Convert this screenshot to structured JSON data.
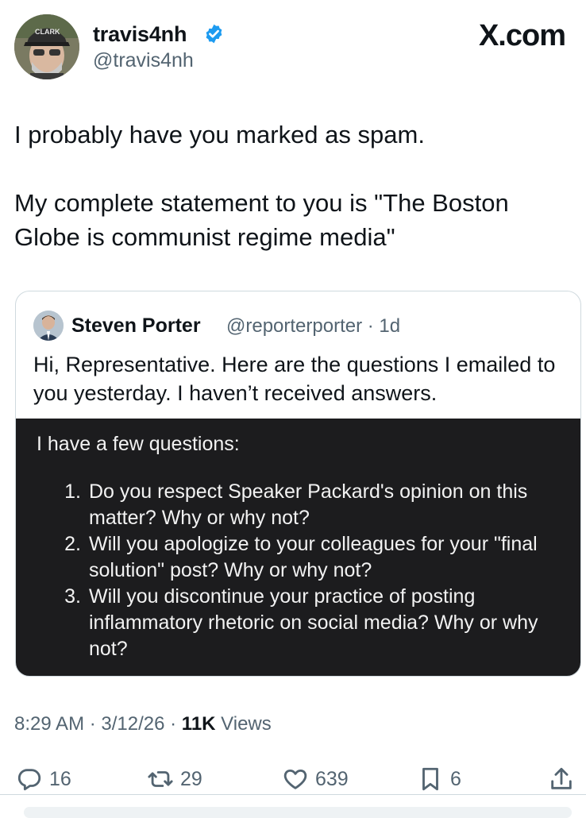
{
  "author": {
    "display_name": "travis4nh",
    "handle": "@travis4nh",
    "verified": true,
    "cap_text": "CLARK"
  },
  "brand": "X.com",
  "tweet": {
    "paragraph_1": "I probably have you marked as spam.",
    "paragraph_2": "My complete statement to you is \"The Boston Globe is communist regime media\""
  },
  "quote": {
    "name": "Steven Porter",
    "handle": "@reporterporter",
    "time": "· 1d",
    "text": "Hi, Representative. Here are the questions I emailed to you yesterday. I haven’t received answers.",
    "media": {
      "heading": "I have a few questions:",
      "items": [
        {
          "num": "1.",
          "text": "Do you respect Speaker Packard's opinion on this matter? Why or why not?"
        },
        {
          "num": "2.",
          "text": "Will you apologize to your colleagues for your \"final solution\" post? Why or why not?"
        },
        {
          "num": "3.",
          "text": "Will you discontinue your practice of posting inflammatory rhetoric on social media? Why or why not?"
        }
      ]
    }
  },
  "meta": {
    "time": "8:29 AM",
    "date": "3/12/26",
    "views_count": "11K",
    "views_label": "Views"
  },
  "actions": {
    "replies": "16",
    "reposts": "29",
    "likes": "639",
    "bookmarks": "6"
  },
  "colors": {
    "verified": "#1d9bf0",
    "secondary_text": "#536471",
    "media_bg": "#1c1c1e"
  }
}
